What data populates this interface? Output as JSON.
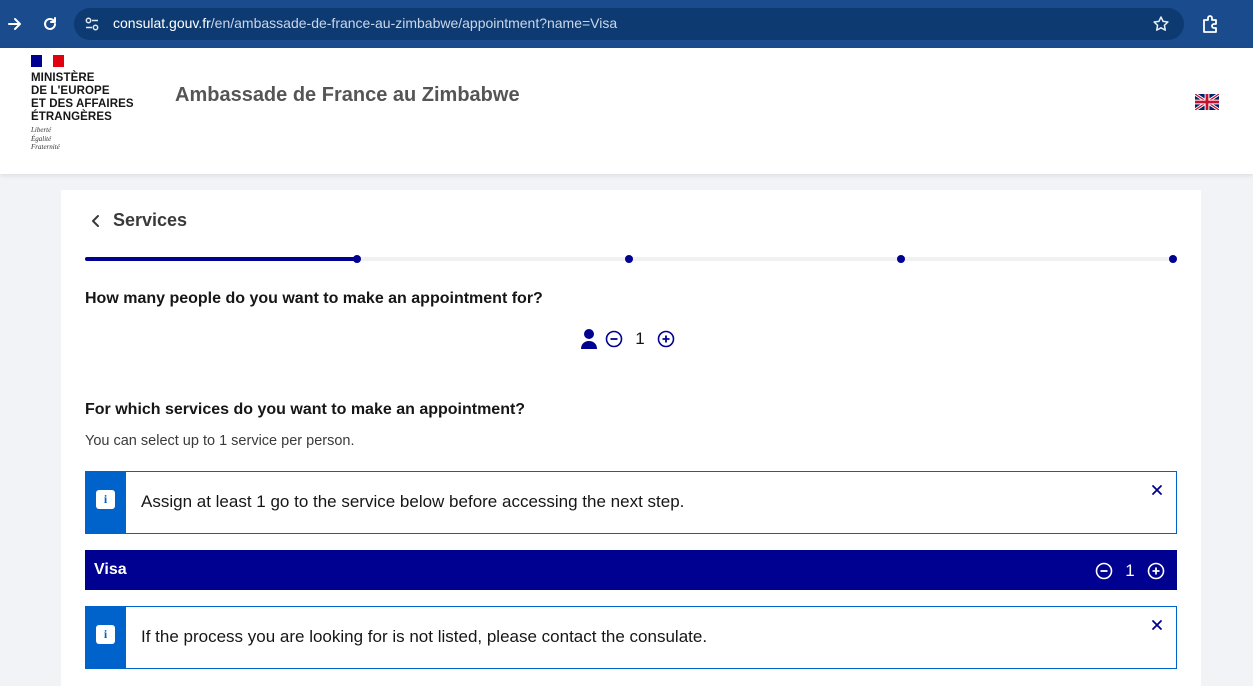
{
  "browser": {
    "url_host": "consulat.gouv.fr",
    "url_path": "/en/ambassade-de-france-au-zimbabwe/appointment?name=Visa"
  },
  "header": {
    "ministry_lines": [
      "MINISTÈRE",
      "DE L'EUROPE",
      "ET DES AFFAIRES",
      "ÉTRANGÈRES"
    ],
    "motto_lines": [
      "Liberté",
      "Égalité",
      "Fraternité"
    ],
    "site_title": "Ambassade de France au Zimbabwe",
    "language_flag": "uk-flag-icon"
  },
  "breadcrumb": {
    "back_label": "Services"
  },
  "progress": {
    "current_step": 1,
    "total_steps": 4
  },
  "people": {
    "question": "How many people do you want to make an appointment for?",
    "count": "1"
  },
  "services": {
    "question": "For which services do you want to make an appointment?",
    "hint": "You can select up to 1 service per person.",
    "alert_text": "Assign at least 1 go to the service below before accessing the next step.",
    "items": [
      {
        "label": "Visa",
        "count": "1"
      }
    ],
    "info_text": "If the process you are looking for is not listed, please contact the consulate."
  },
  "colors": {
    "primary": "#000091",
    "info": "#0063cb",
    "browser_bar": "#1a4b8c"
  }
}
